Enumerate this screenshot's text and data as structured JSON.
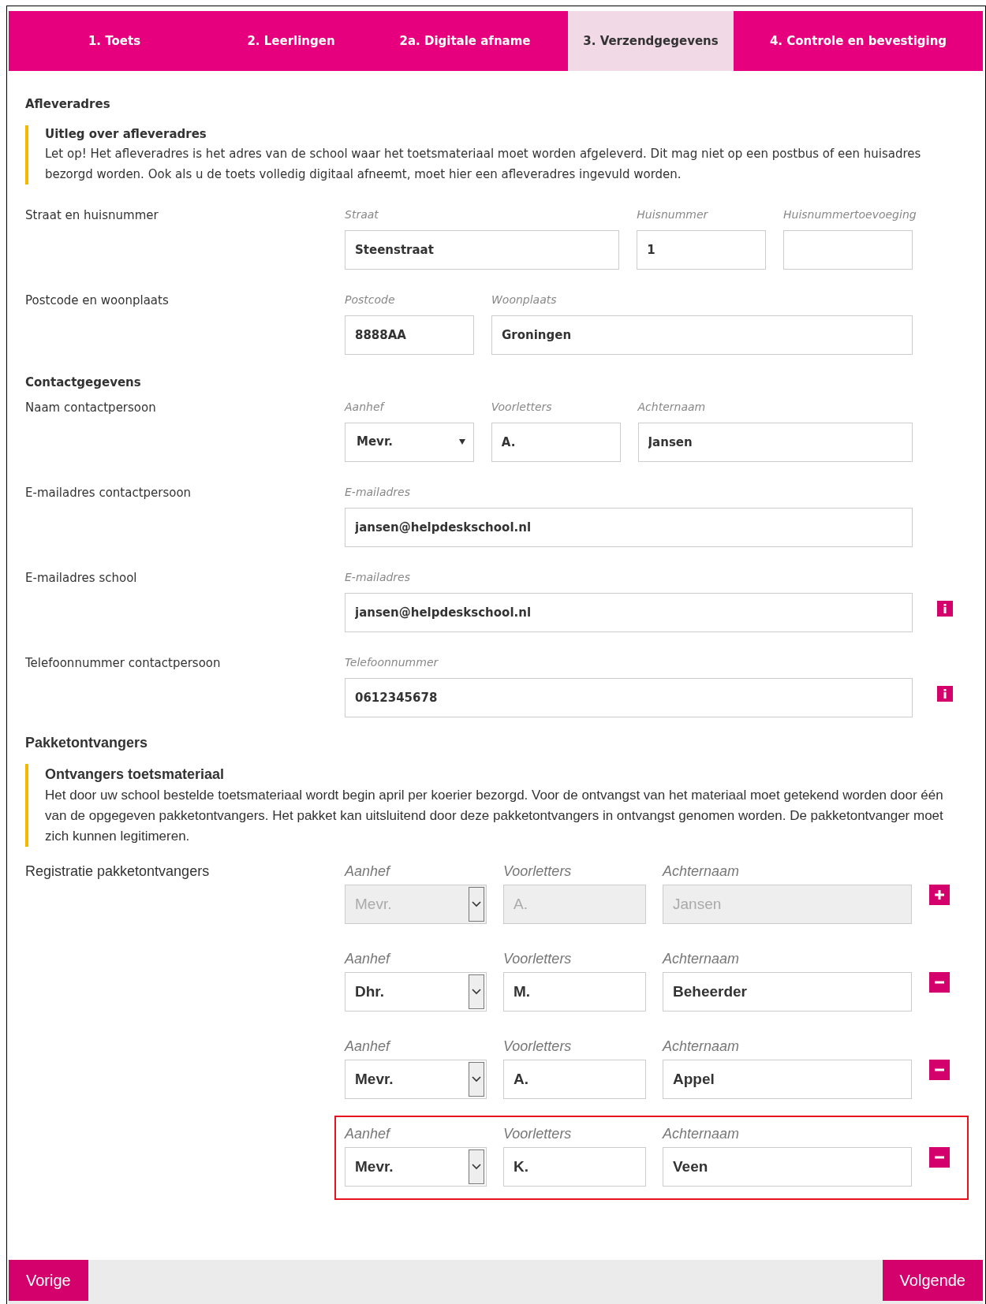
{
  "tabs": [
    {
      "label": "1. Toets",
      "selected": false
    },
    {
      "label": "2. Leerlingen",
      "selected": false
    },
    {
      "label": "2a. Digitale afname",
      "selected": false
    },
    {
      "label": "3. Verzendgegevens",
      "selected": true
    },
    {
      "label": "4. Controle en bevestiging",
      "selected": false
    }
  ],
  "sections": [
    {
      "heading": "Afleveradres",
      "note": {
        "title": "Uitleg over afleveradres",
        "text": "Let op! Het afleveradres is het adres van de school waar het toetsmateriaal moet worden afgeleverd. Dit mag niet op een postbus of een huisadres bezorgd worden. Ook als u de toets volledig digitaal afneemt, moet hier een afleveradres ingevuld worden."
      },
      "rows": [
        {
          "label": "Straat en huisnummer",
          "info": false,
          "fields": [
            {
              "kind": "text",
              "label": "Straat",
              "value": "Steenstraat"
            },
            {
              "kind": "text",
              "label": "Huisnummer",
              "value": "1"
            },
            {
              "kind": "text",
              "label": "Huisnummertoevoeging"
            }
          ]
        },
        {
          "label": "Postcode en woonplaats",
          "info": false,
          "fields": [
            {
              "kind": "text",
              "label": "Postcode",
              "value": "8888AA"
            },
            {
              "kind": "text",
              "label": "Woonplaats",
              "value": "Groningen"
            }
          ]
        }
      ]
    },
    {
      "heading": "Contactgegevens",
      "rows": [
        {
          "label": "Naam contactpersoon",
          "info": false,
          "fields": [
            {
              "kind": "select",
              "label": "Aanhef",
              "value": "Mevr."
            },
            {
              "kind": "text",
              "label": "Voorletters",
              "value": "A."
            },
            {
              "kind": "text",
              "label": "Achternaam",
              "value": "Jansen"
            }
          ]
        },
        {
          "label": "E-mailadres contactpersoon",
          "info": false,
          "fields": [
            {
              "kind": "text",
              "label": "E-mailadres",
              "value": "jansen@helpdeskschool.nl"
            }
          ]
        },
        {
          "label": "E-mailadres school",
          "info": true,
          "fields": [
            {
              "kind": "text",
              "label": "E-mailadres",
              "value": "jansen@helpdeskschool.nl"
            }
          ]
        },
        {
          "label": "Telefoonnummer contactpersoon",
          "info": true,
          "fields": [
            {
              "kind": "text",
              "label": "Telefoonnummer",
              "value": "0612345678"
            }
          ]
        }
      ]
    }
  ],
  "parcel_recipients": {
    "heading": "Pakketontvangers",
    "note": {
      "title": "Ontvangers toetsmateriaal",
      "text": "Het door uw school bestelde toetsmateriaal wordt begin april per koerier bezorgd. Voor de ontvangst van het materiaal moet getekend worden door één van de opgegeven pakketontvangers. Het pakket kan uitsluitend door deze pakketontvangers in ontvangst genomen worden. De pakketontvanger moet zich kunnen legitimeren."
    },
    "label": "Registratie pakketontvangers",
    "recipients": [
      {
        "disabled": true,
        "highlighted": false,
        "kind": "add",
        "fields": [
          {
            "label": "Aanhef",
            "value": "Mevr."
          },
          {
            "label": "Voorletters",
            "value": "A."
          },
          {
            "label": "Achternaam",
            "value": "Jansen"
          }
        ]
      },
      {
        "disabled": false,
        "highlighted": false,
        "kind": "remove",
        "fields": [
          {
            "label": "Aanhef",
            "value": "Dhr."
          },
          {
            "label": "Voorletters",
            "value": "M."
          },
          {
            "label": "Achternaam",
            "value": "Beheerder"
          }
        ]
      },
      {
        "disabled": false,
        "highlighted": false,
        "kind": "remove",
        "fields": [
          {
            "label": "Aanhef",
            "value": "Mevr."
          },
          {
            "label": "Voorletters",
            "value": "A."
          },
          {
            "label": "Achternaam",
            "value": "Appel"
          }
        ]
      },
      {
        "disabled": false,
        "highlighted": true,
        "kind": "remove",
        "fields": [
          {
            "label": "Aanhef",
            "value": "Mevr."
          },
          {
            "label": "Voorletters",
            "value": "K."
          },
          {
            "label": "Achternaam",
            "value": "Veen"
          }
        ]
      }
    ]
  },
  "footer": {
    "buttons": [
      "Vorige",
      "Volgende"
    ]
  }
}
